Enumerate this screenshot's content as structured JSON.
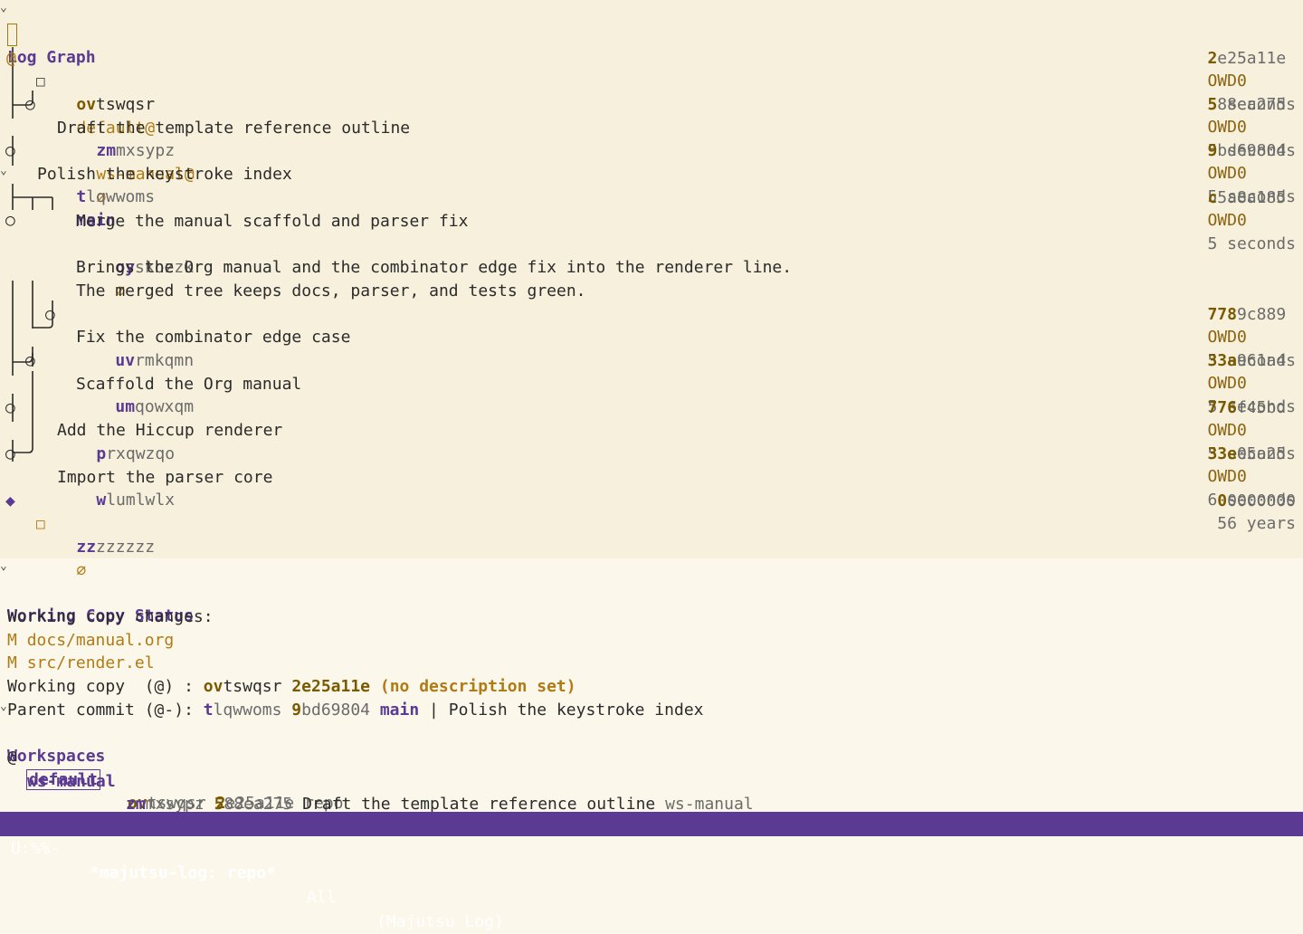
{
  "sections": {
    "log_graph": "Log Graph",
    "working_copy_status": "Working Copy Status",
    "workspaces": "Workspaces"
  },
  "symbols": {
    "working_copy": "@",
    "node": "○",
    "root": "◆",
    "empty_box": "□",
    "empty_mark": "∅",
    "fold": "⌄"
  },
  "commits": [
    {
      "id_prefix": "ov",
      "id_rest": "tswqsr",
      "bookmark": "default@",
      "hash_prefix": "2",
      "hash_rest": "e25a11e",
      "author": "OWD0",
      "age": "5 seconds"
    },
    {
      "id_prefix": "zm",
      "id_rest": "mxsypz",
      "bookmark": "ws-manual@",
      "empty": "∅",
      "hash_prefix": "5",
      "hash_rest": "88ea275",
      "author": "OWD0",
      "age": "5 seconds",
      "desc": "Draft the template reference outline"
    },
    {
      "id_prefix": "t",
      "id_rest": "lqwwoms",
      "bookmark": "main",
      "hash_prefix": "9",
      "hash_rest": "bd69804",
      "author": "OWD0",
      "age": "5 seconds",
      "desc": "Polish the keystroke index"
    },
    {
      "id_prefix": "oy",
      "id_rest": "skozzk",
      "empty": "∅",
      "hash_prefix": "c",
      "hash_rest": "5a8a185",
      "author": "OWD0",
      "age": "5 seconds",
      "desc": "Merge the manual scaffold and parser fix",
      "body1": "Brings the Org manual and the combinator edge fix into the renderer line.",
      "body2": "The merged tree keeps docs, parser, and tests green."
    },
    {
      "id_prefix": "uv",
      "id_rest": "rmkqmn",
      "hash_prefix": "778",
      "hash_rest": "9c889",
      "author": "OWD0",
      "age": "5 seconds",
      "desc": "Fix the combinator edge case"
    },
    {
      "id_prefix": "um",
      "id_rest": "qowxqm",
      "hash_prefix": "33a",
      "hash_rest": "961a4",
      "author": "OWD0",
      "age": "5 seconds",
      "desc": "Scaffold the Org manual"
    },
    {
      "id_prefix": "p",
      "id_rest": "rxqwzqo",
      "hash_prefix": "776",
      "hash_rest": "f45bd",
      "author": "OWD0",
      "age": "5 seconds",
      "desc": "Add the Hiccup renderer"
    },
    {
      "id_prefix": "w",
      "id_rest": "lumlwlx",
      "hash_prefix": "33e",
      "hash_rest": "05a25",
      "author": "OWD0",
      "age": "6 seconds",
      "desc": "Import the parser core"
    },
    {
      "id_prefix": "zz",
      "id_rest": "zzzzzz",
      "empty": "∅",
      "hash_prefix": "0",
      "hash_rest": "0000000",
      "age": "56 years"
    }
  ],
  "status": {
    "changes_label": "Working copy changes:",
    "files": [
      {
        "mod": "M",
        "path": "docs/manual.org"
      },
      {
        "mod": "M",
        "path": "src/render.el"
      }
    ],
    "wc_label": "Working copy  (@) : ",
    "wc_id_prefix": "ov",
    "wc_id_rest": "tswqsr",
    "wc_hash": "2e25a11e",
    "wc_desc": "(no description set)",
    "parent_label": "Parent commit (@-): ",
    "parent_id_prefix": "t",
    "parent_id_rest": "lqwwoms",
    "parent_hash_prefix": "9",
    "parent_hash_rest": "bd69804",
    "parent_bookmark": "main",
    "sep": "|",
    "parent_desc": "Polish the keystroke index"
  },
  "workspaces": [
    {
      "marker": "@",
      "name": "default",
      "id_prefix": "ov",
      "id_rest": "tswqsr",
      "hash_prefix": "2",
      "hash_rest": "e25a11e",
      "desc": "",
      "tail": "repo"
    },
    {
      "marker": "",
      "name": "ws-manual",
      "id_prefix": "zm",
      "id_rest": "mxsypz",
      "hash_prefix": "5",
      "hash_rest": "88ea275",
      "desc": "Draft the template reference outline",
      "tail": "ws-manual"
    }
  ],
  "modeline": {
    "state": "U:%%-",
    "buffer": "*majutsu-log: repo*",
    "position": "All",
    "mode": "(Majutsu Log)"
  },
  "colors": {
    "background": "#fbf7ea",
    "accent": "#5b3a93",
    "bookmark": "#b07a14",
    "hash": "#7a5a00",
    "modeline_bg": "#5b3a93"
  }
}
